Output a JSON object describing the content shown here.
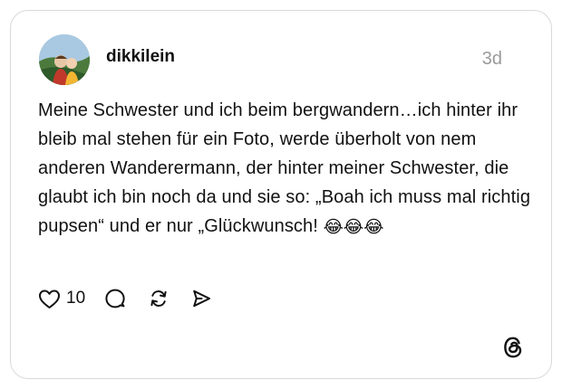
{
  "post": {
    "username": "dikkilein",
    "timestamp": "3d",
    "text": "Meine Schwester und ich beim bergwandern…ich hinter ihr bleib mal stehen für ein Foto, werde überholt von nem anderen Wanderermann, der hinter meiner Schwester, die glaubt ich bin noch da und sie so: „Boah ich muss mal richtig pupsen“ und er nur „Glückwunsch!",
    "emojis": "😂😂😂",
    "like_count": "10"
  },
  "icons": {
    "like": "heart-icon",
    "comment": "comment-icon",
    "repost": "repost-icon",
    "share": "share-icon",
    "brand": "threads-logo-icon"
  },
  "colors": {
    "text": "#111111",
    "muted": "#9a9a9a",
    "border": "#d9d9d9"
  }
}
